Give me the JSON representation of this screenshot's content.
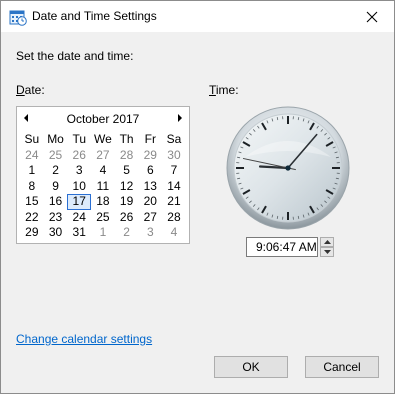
{
  "window": {
    "title": "Date and Time Settings",
    "instruction": "Set the date and time:"
  },
  "date_section": {
    "label": "Date:"
  },
  "time_section": {
    "label": "Time:",
    "value": "9:06:47 AM"
  },
  "calendar": {
    "month_title": "October 2017",
    "days_of_week": [
      "Su",
      "Mo",
      "Tu",
      "We",
      "Th",
      "Fr",
      "Sa"
    ],
    "weeks": [
      [
        {
          "d": "24",
          "m": true
        },
        {
          "d": "25",
          "m": true
        },
        {
          "d": "26",
          "m": true
        },
        {
          "d": "27",
          "m": true
        },
        {
          "d": "28",
          "m": true
        },
        {
          "d": "29",
          "m": true
        },
        {
          "d": "30",
          "m": true
        }
      ],
      [
        {
          "d": "1"
        },
        {
          "d": "2"
        },
        {
          "d": "3"
        },
        {
          "d": "4"
        },
        {
          "d": "5"
        },
        {
          "d": "6"
        },
        {
          "d": "7"
        }
      ],
      [
        {
          "d": "8"
        },
        {
          "d": "9"
        },
        {
          "d": "10"
        },
        {
          "d": "11"
        },
        {
          "d": "12"
        },
        {
          "d": "13"
        },
        {
          "d": "14"
        }
      ],
      [
        {
          "d": "15"
        },
        {
          "d": "16"
        },
        {
          "d": "17",
          "t": true
        },
        {
          "d": "18"
        },
        {
          "d": "19"
        },
        {
          "d": "20"
        },
        {
          "d": "21"
        }
      ],
      [
        {
          "d": "22"
        },
        {
          "d": "23"
        },
        {
          "d": "24"
        },
        {
          "d": "25"
        },
        {
          "d": "26"
        },
        {
          "d": "27"
        },
        {
          "d": "28"
        }
      ],
      [
        {
          "d": "29"
        },
        {
          "d": "30"
        },
        {
          "d": "31"
        },
        {
          "d": "1",
          "m": true
        },
        {
          "d": "2",
          "m": true
        },
        {
          "d": "3",
          "m": true
        },
        {
          "d": "4",
          "m": true
        }
      ]
    ]
  },
  "clock": {
    "hours": 9,
    "minutes": 6,
    "seconds": 47
  },
  "links": {
    "change_calendar": "Change calendar settings"
  },
  "buttons": {
    "ok": "OK",
    "cancel": "Cancel"
  },
  "colors": {
    "link": "#0066cc",
    "selection": "#2a6fd3",
    "muted": "#8a8a8a"
  }
}
